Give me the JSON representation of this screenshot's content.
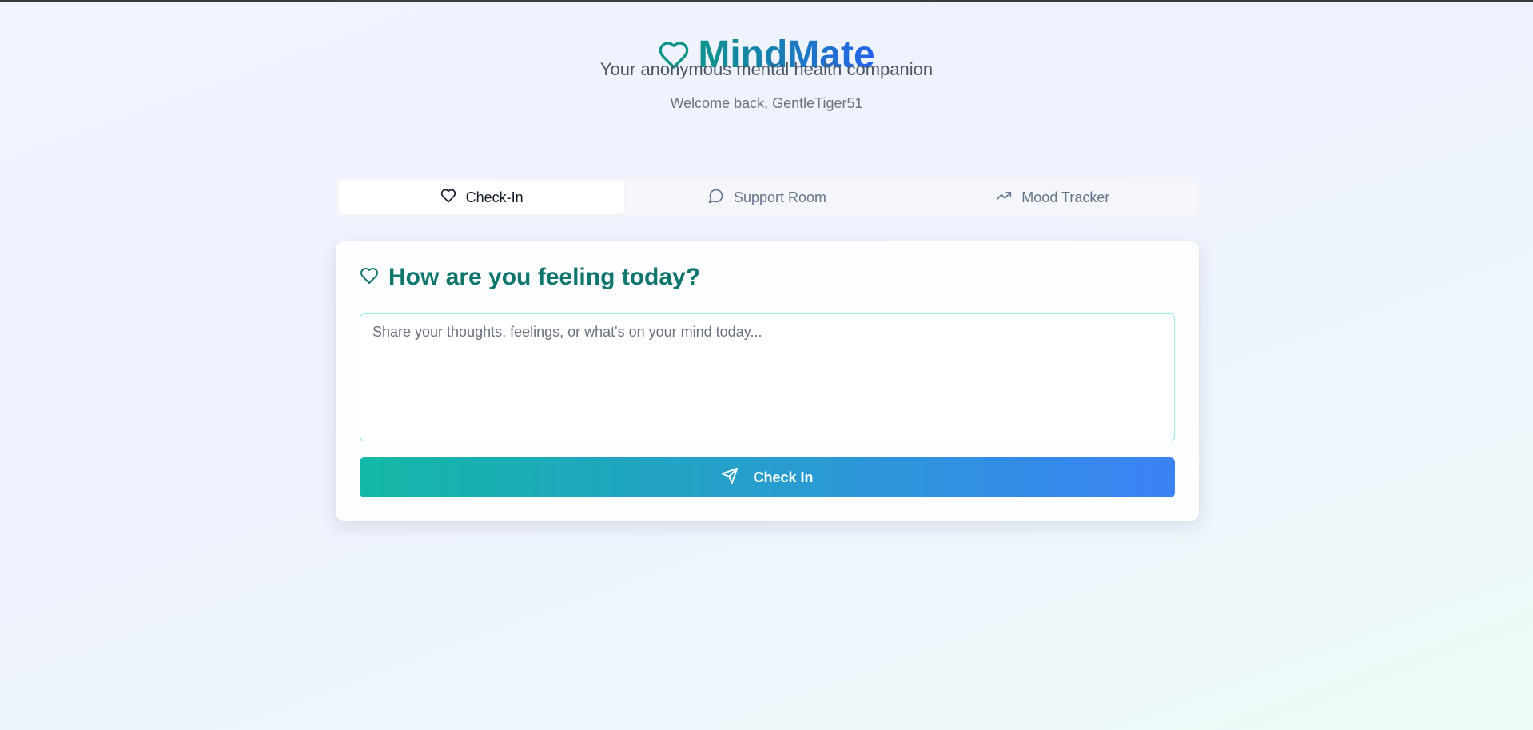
{
  "app": {
    "title": "MindMate",
    "subtitle": "Your anonymous mental health companion",
    "welcome": "Welcome back, GentleTiger51",
    "logo_icon": "heart-icon"
  },
  "tabs": [
    {
      "label": "Check-In",
      "icon": "heart-icon",
      "active": true
    },
    {
      "label": "Support Room",
      "icon": "chat-bubble-icon",
      "active": false
    },
    {
      "label": "Mood Tracker",
      "icon": "trending-up-icon",
      "active": false
    }
  ],
  "checkin_card": {
    "title": "How are you feeling today?",
    "title_icon": "heart-icon",
    "textarea_value": "",
    "textarea_placeholder": "Share your thoughts, feelings, or what's on your mind today...",
    "submit_label": "Check In",
    "submit_icon": "send-icon"
  },
  "colors": {
    "brand_teal": "#0d9488",
    "brand_blue": "#2563eb",
    "heading_teal": "#0f766e",
    "button_gradient_start": "#14b8a6",
    "button_gradient_end": "#3b82f6"
  }
}
